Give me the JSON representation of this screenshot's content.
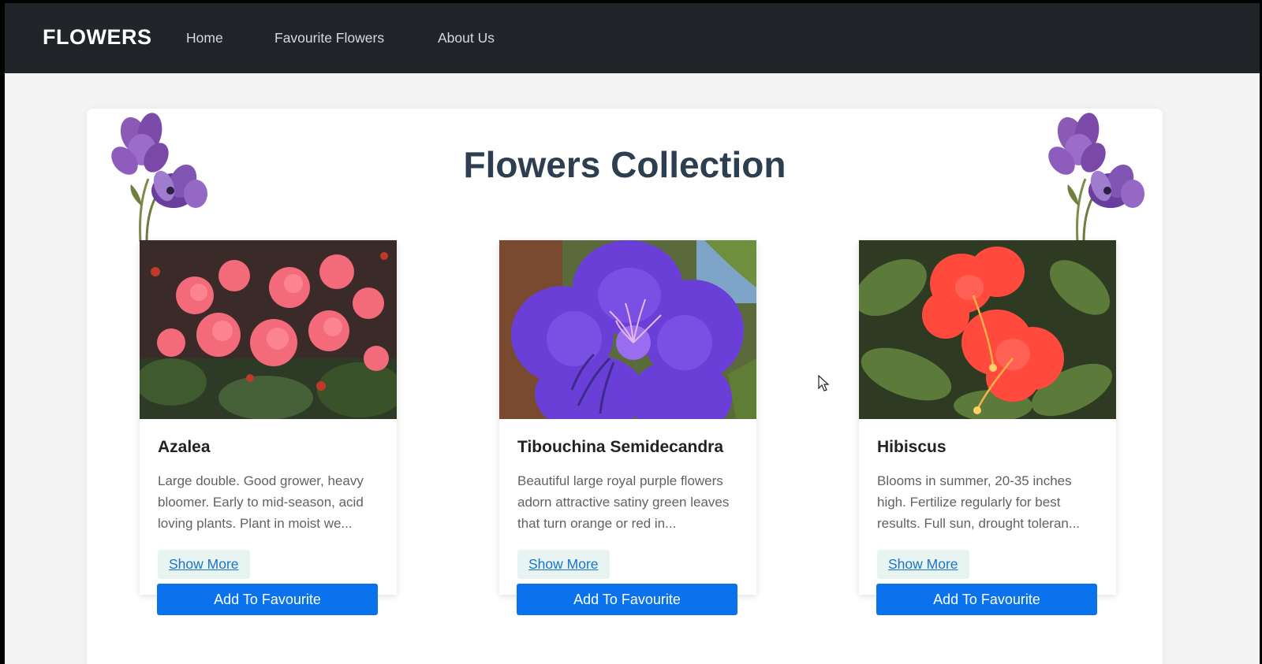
{
  "navbar": {
    "brand": "FLOWERS",
    "links": [
      "Home",
      "Favourite Flowers",
      "About Us"
    ]
  },
  "main": {
    "title": "Flowers Collection"
  },
  "cards": [
    {
      "name": "Azalea",
      "description": "Large double. Good grower, heavy bloomer. Early to mid-season, acid loving plants. Plant in moist we...",
      "show_more": "Show More",
      "add_button": "Add To Favourite"
    },
    {
      "name": "Tibouchina Semidecandra",
      "description": "Beautiful large royal purple flowers adorn attractive satiny green leaves that turn orange or red in...",
      "show_more": "Show More",
      "add_button": "Add To Favourite"
    },
    {
      "name": "Hibiscus",
      "description": "Blooms in summer, 20-35 inches high. Fertilize regularly for best results. Full sun, drought toleran...",
      "show_more": "Show More",
      "add_button": "Add To Favourite"
    }
  ],
  "colors": {
    "navbar_bg": "#212529",
    "page_bg": "#f4f4f4",
    "title": "#2c3e50",
    "button": "#0a72ec",
    "link": "#1a73c8",
    "show_more_bg": "#e8f4f1"
  },
  "icons": {
    "decoration": "purple-flower-illustration",
    "cursor": "mouse-pointer"
  }
}
